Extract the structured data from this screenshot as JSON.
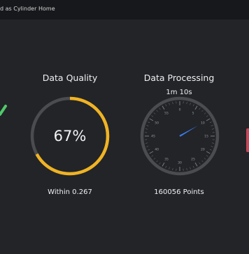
{
  "header": {
    "breadcrumb_partial": "d as Cylinder",
    "home_label": "Home"
  },
  "panels": {
    "quality": {
      "title": "Data Quality",
      "value_text": "67%",
      "value_fraction": 0.67,
      "footer": "Within 0.267",
      "color": "#f0b323"
    },
    "processing": {
      "title": "Data Processing",
      "elapsed": "1m 10s",
      "footer": "160056 Points",
      "needle_color": "#3d7bf0",
      "tick_labels": [
        "0",
        "5",
        "10",
        "15",
        "20",
        "25",
        "30",
        "35",
        "40",
        "45",
        "50",
        "55"
      ],
      "elapsed_seconds": 70
    }
  },
  "colors": {
    "background": "#222428",
    "topbar": "#17181b",
    "ring_track": "#4a4c50",
    "left_icon": "#4fc96a",
    "right_icon": "#c7475a"
  },
  "icons": {
    "left": "check-icon",
    "right": "error-icon"
  }
}
